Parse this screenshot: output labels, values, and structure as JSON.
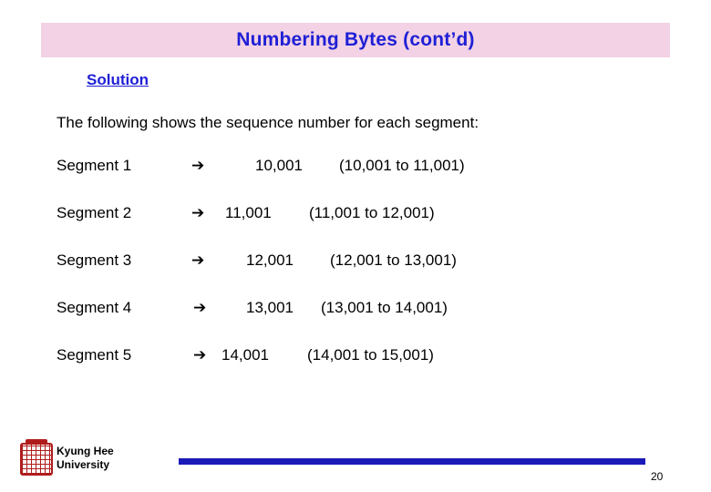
{
  "slide": {
    "title": "Numbering Bytes (cont’d)",
    "section_heading": "Solution",
    "intro": "The following shows the sequence number for each segment:",
    "arrow_glyph": "➔",
    "segments": [
      {
        "label": "Segment 1",
        "number": "10,001",
        "range": "(10,001 to 11,001)"
      },
      {
        "label": "Segment 2",
        "number": "11,001",
        "range": "(11,001 to 12,001)"
      },
      {
        "label": "Segment 3",
        "number": "12,001",
        "range": "(12,001 to 13,001)"
      },
      {
        "label": "Segment 4",
        "number": "13,001",
        "range": "(13,001 to 14,001)"
      },
      {
        "label": "Segment 5",
        "number": "14,001",
        "range": "(14,001 to 15,001)"
      }
    ],
    "footer": {
      "university_line1": "Kyung Hee",
      "university_line2": "University",
      "page_number": "20"
    }
  }
}
